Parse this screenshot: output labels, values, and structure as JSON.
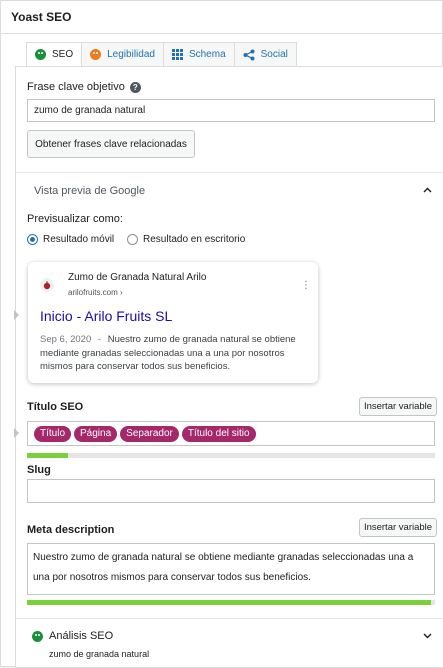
{
  "panel": {
    "title": "Yoast SEO"
  },
  "tabs": [
    {
      "label": "SEO",
      "icon": "green-smiley-icon"
    },
    {
      "label": "Legibilidad",
      "icon": "orange-smiley-icon"
    },
    {
      "label": "Schema",
      "icon": "grid-icon"
    },
    {
      "label": "Social",
      "icon": "share-icon"
    }
  ],
  "keyphrase": {
    "label": "Frase clave objetivo",
    "help_icon": "?",
    "value": "zumo de granada natural",
    "related_button": "Obtener frases clave relacionadas"
  },
  "preview": {
    "title": "Vista previa de Google",
    "preview_as_label": "Previsualizar como:",
    "options": [
      "Resultado móvil",
      "Resultado en escritorio"
    ],
    "selected": "Resultado móvil",
    "serp": {
      "site_name": "Zumo de Granada Natural Arilo",
      "url": "arilofruits.com ›",
      "menu": "⋮",
      "link_title": "Inicio - Arilo Fruits SL",
      "date": "Sep 6, 2020",
      "separator": "-",
      "description": "Nuestro zumo de granada natural se obtiene mediante granadas seleccionadas una a una por nosotros mismos para conservar todos sus beneficios."
    }
  },
  "seo_title": {
    "label": "Título SEO",
    "insert_button": "Insertar variable",
    "pills": [
      "Título",
      "Página",
      "Separador",
      "Título del sitio"
    ],
    "progress": 0.1,
    "progress_color": "#7ad03a"
  },
  "slug": {
    "label": "Slug",
    "value": ""
  },
  "meta": {
    "label": "Meta description",
    "insert_button": "Insertar variable",
    "value": "Nuestro zumo de granada natural se obtiene mediante granadas seleccionadas una a una por nosotros mismos para conservar todos sus beneficios.",
    "progress": 0.99,
    "progress_color": "#7ad03a"
  },
  "analysis": {
    "title": "Análisis SEO",
    "keyphrase": "zumo de granada natural"
  },
  "colors": {
    "accent": "#2271b1",
    "pill": "#a4286a",
    "good": "#1a8f3c",
    "ok": "#ee7c1b"
  }
}
